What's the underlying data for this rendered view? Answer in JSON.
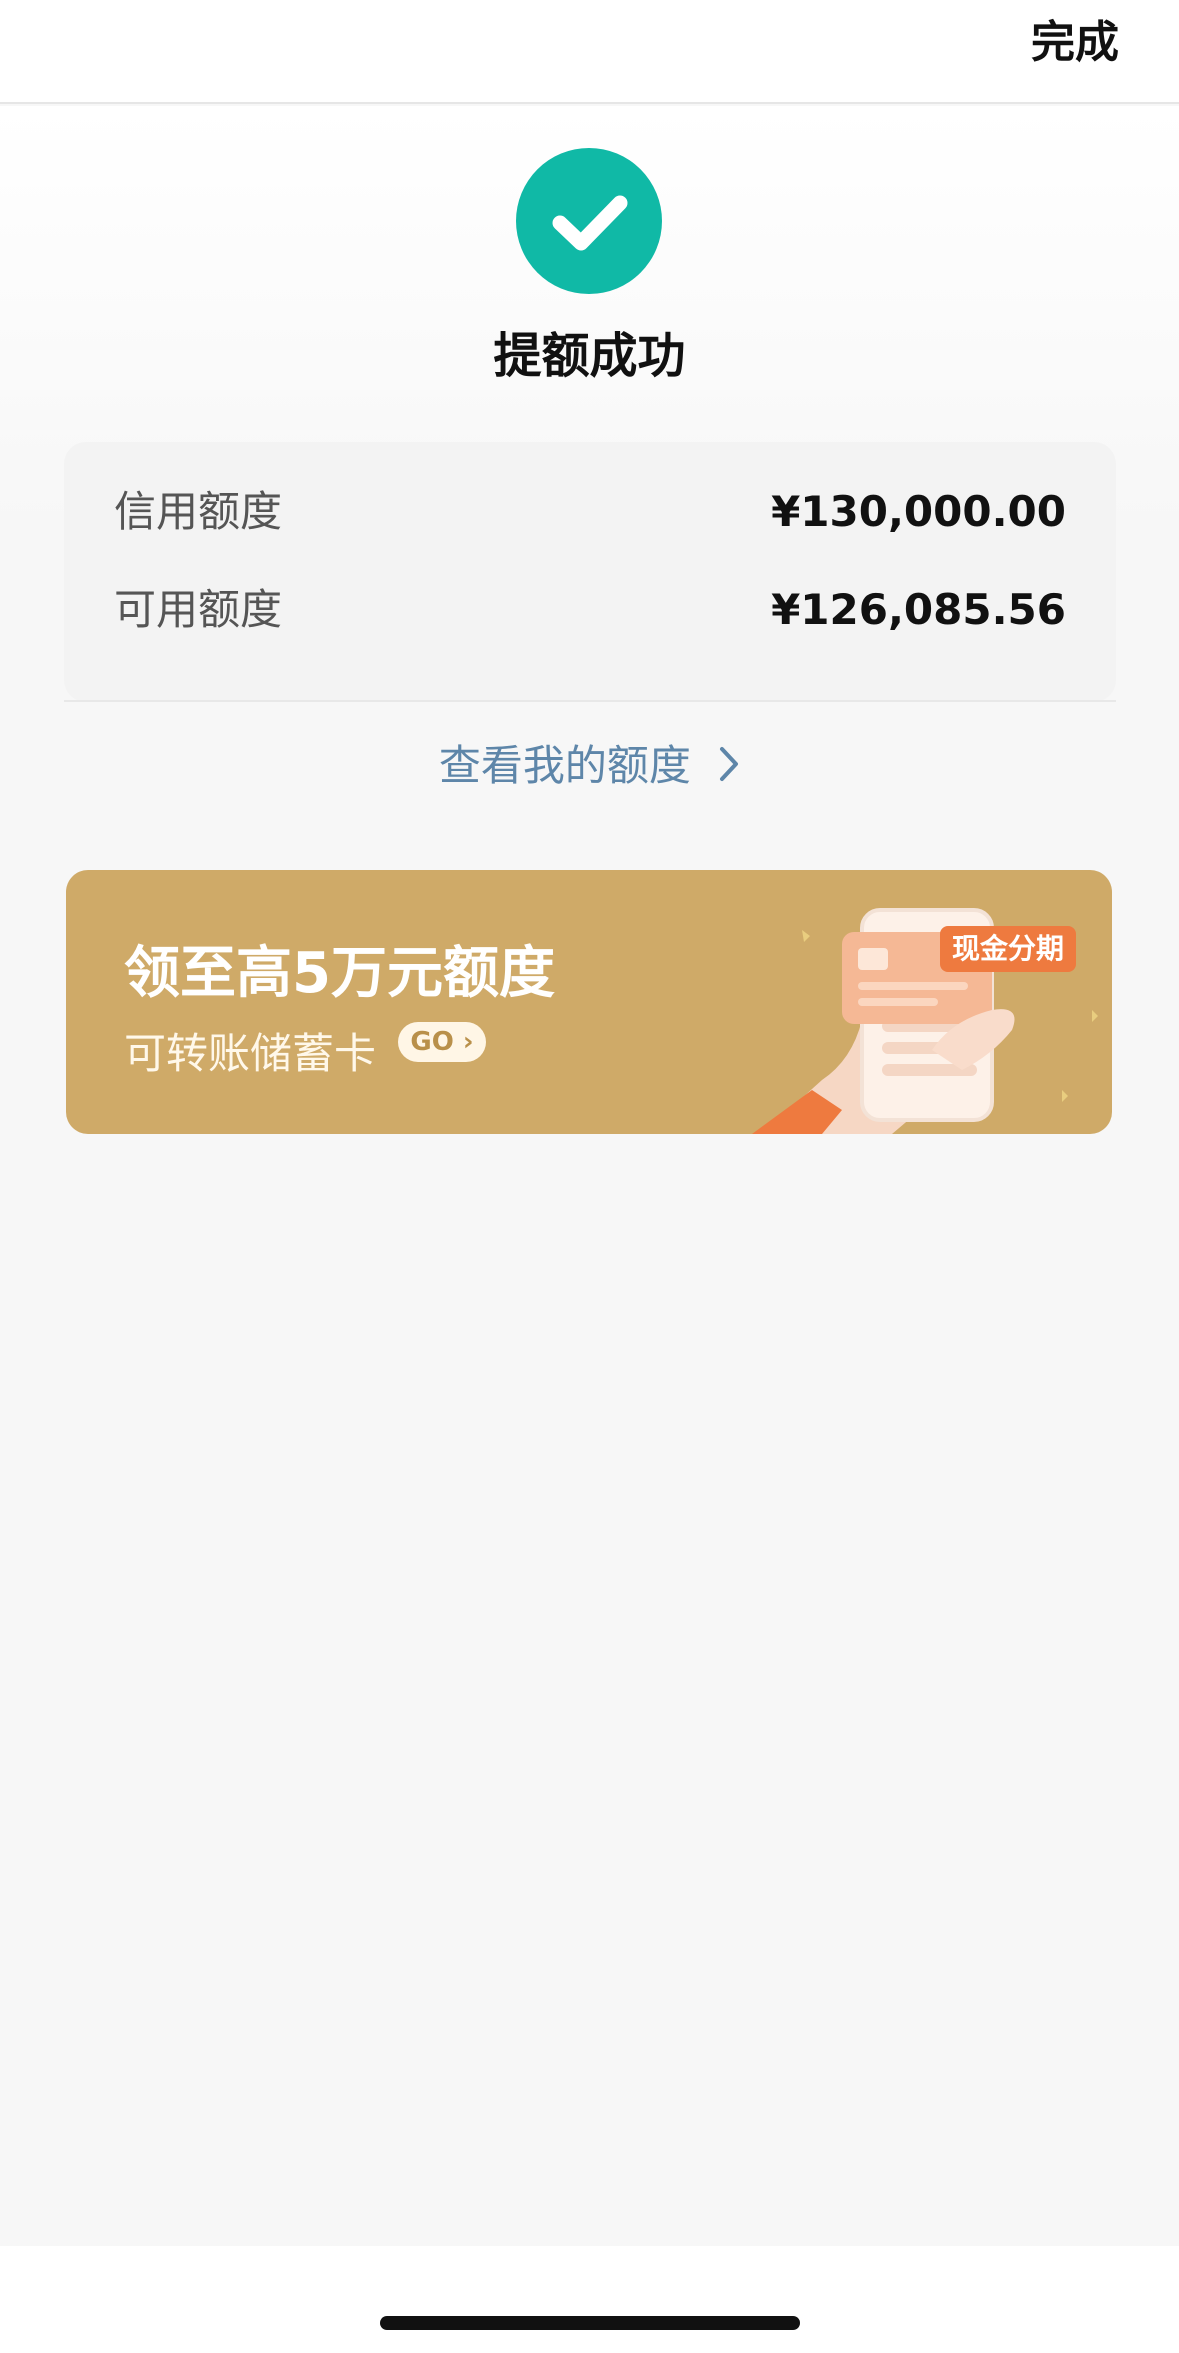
{
  "header": {
    "done_label": "完成"
  },
  "result": {
    "icon": "check-icon",
    "title": "提额成功",
    "accent": "#10b9a6"
  },
  "limits": {
    "rows": [
      {
        "label": "信用额度",
        "value": "¥130,000.00"
      },
      {
        "label": "可用额度",
        "value": "¥126,085.56"
      }
    ],
    "view_link": "查看我的额度"
  },
  "banner": {
    "title": "领至高5万元额度",
    "subtitle": "可转账储蓄卡",
    "go_label": "GO",
    "tag": "现金分期",
    "background": "#cfaa68"
  }
}
